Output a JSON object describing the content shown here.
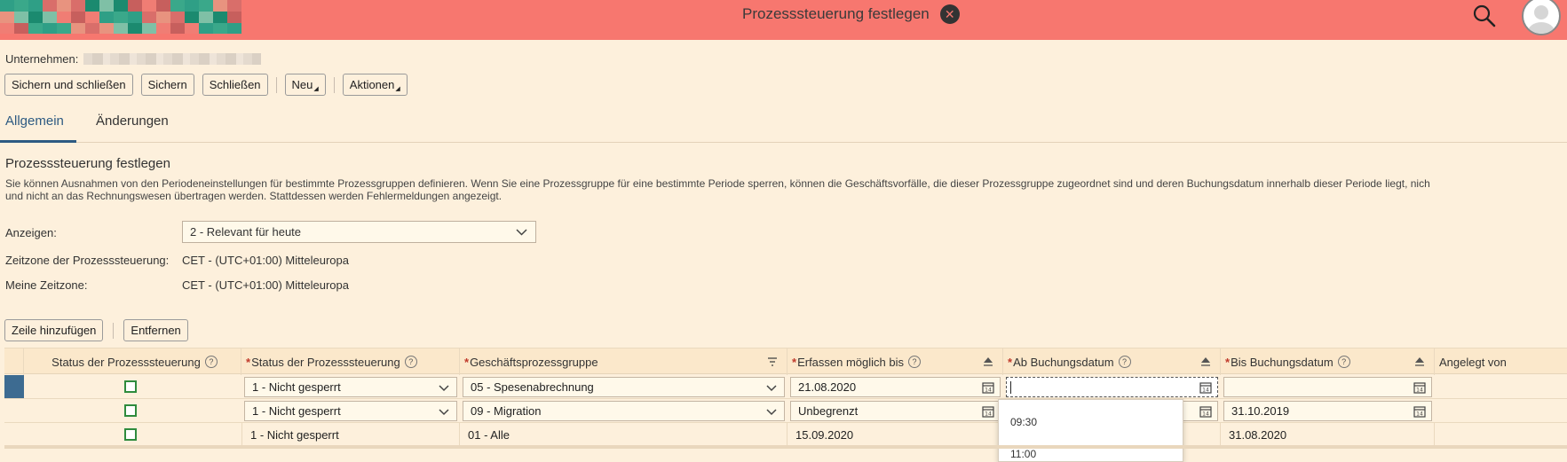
{
  "header": {
    "title": "Prozesssteuerung festlegen",
    "logo_colors": [
      "#2f9f86",
      "#e8937f",
      "#1b8a6f",
      "#f07d74",
      "#3aa88a",
      "#d96e6a",
      "#7fc0a6",
      "#c75f5d"
    ]
  },
  "company": {
    "label": "Unternehmen:"
  },
  "toolbar": {
    "save_close": "Sichern und schließen",
    "save": "Sichern",
    "close": "Schließen",
    "new": "Neu",
    "actions": "Aktionen"
  },
  "tabs": [
    {
      "label": "Allgemein",
      "active": true
    },
    {
      "label": "Änderungen",
      "active": false
    }
  ],
  "section": {
    "title": "Prozesssteuerung festlegen",
    "description_line1": "Sie können Ausnahmen von den Periodeneinstellungen für bestimmte Prozessgruppen definieren. Wenn Sie eine Prozessgruppe für eine bestimmte Periode sperren, können die Geschäftsvorfälle, die dieser Prozessgruppe zugeordnet sind und deren Buchungsdatum innerhalb dieser Periode liegt, nich",
    "description_line2": "und nicht an das Rechnungswesen übertragen werden. Stattdessen werden Fehlermeldungen angezeigt."
  },
  "fields": {
    "show_label": "Anzeigen:",
    "show_value": "2 - Relevant für heute",
    "tz_process_label": "Zeitzone der Prozesssteuerung:",
    "tz_process_value": "CET - (UTC+01:00) Mitteleuropa",
    "tz_mine_label": "Meine Zeitzone:",
    "tz_mine_value": "CET - (UTC+01:00) Mitteleuropa"
  },
  "table_toolbar": {
    "add_row": "Zeile hinzufügen",
    "remove": "Entfernen"
  },
  "table": {
    "headers": {
      "status_icon": "Status der Prozesssteuerung",
      "status": "Status der Prozesssteuerung",
      "group": "Geschäftsprozessgruppe",
      "capture_until": "Erfassen möglich bis",
      "from_date": "Ab Buchungsdatum",
      "to_date": "Bis Buchungsdatum",
      "created_by": "Angelegt von"
    },
    "rows": [
      {
        "status": "1 - Nicht gesperrt",
        "group": "05 - Spesenabrechnung",
        "capture_until": "21.08.2020",
        "from_date": "",
        "to_date": ""
      },
      {
        "status": "1 - Nicht gesperrt",
        "group": "09 - Migration",
        "capture_until": "Unbegrenzt",
        "from_date": "",
        "to_date": "31.10.2019"
      },
      {
        "status": "1 - Nicht gesperrt",
        "group": "01 - Alle",
        "capture_until": "15.09.2020",
        "from_date": "",
        "to_date": "31.08.2020"
      }
    ]
  },
  "dropdown": {
    "items": [
      "09:30",
      "11:00"
    ]
  }
}
